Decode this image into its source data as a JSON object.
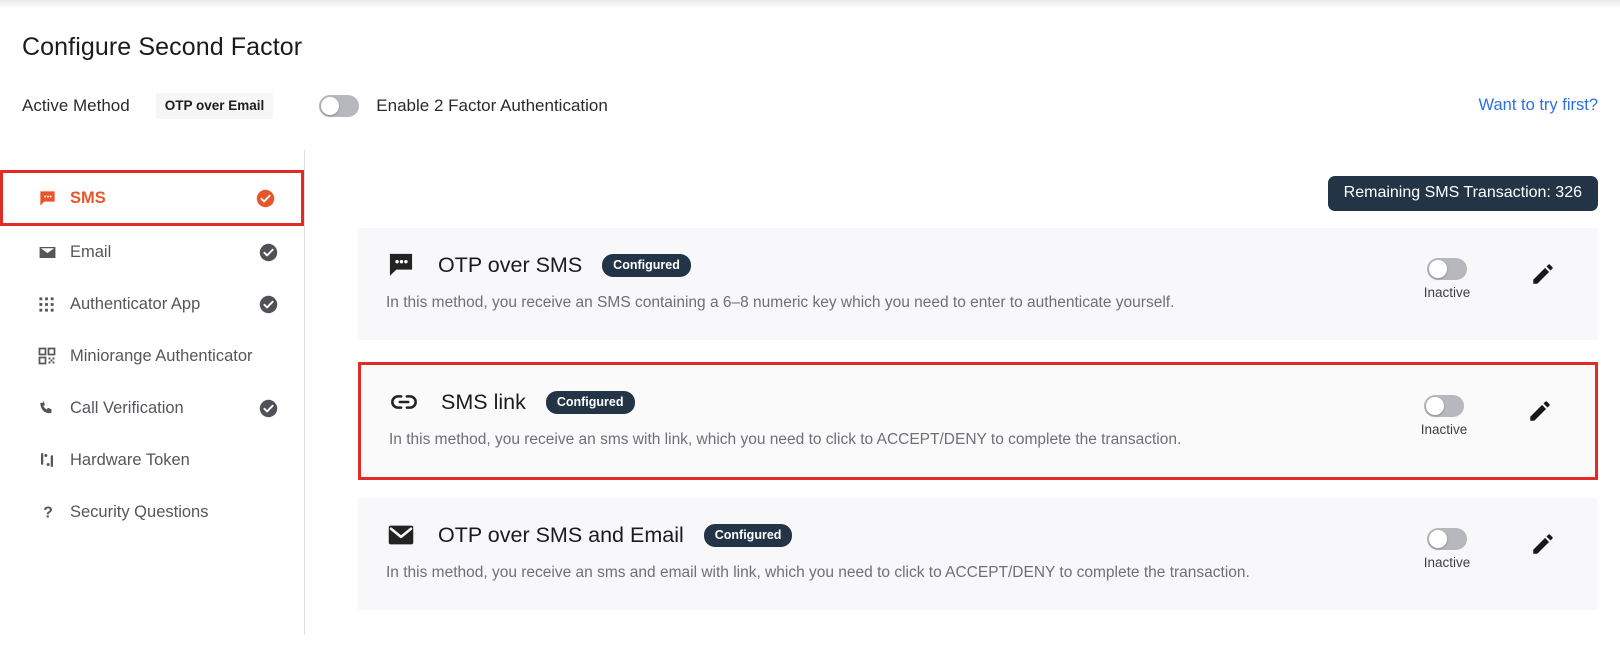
{
  "header": {
    "title": "Configure Second Factor",
    "active_method_label": "Active Method",
    "active_method_value": "OTP over Email",
    "enable_2fa_label": "Enable 2 Factor Authentication",
    "enable_2fa_state": "off",
    "try_first_link": "Want to try first?",
    "link_color": "#2f6fe4"
  },
  "sidebar": {
    "items": [
      {
        "label": "SMS",
        "icon": "sms-chat-icon",
        "configured": true,
        "active": true
      },
      {
        "label": "Email",
        "icon": "envelope-icon",
        "configured": true,
        "active": false
      },
      {
        "label": "Authenticator App",
        "icon": "grid-dots-icon",
        "configured": true,
        "active": false
      },
      {
        "label": "Miniorange Authenticator",
        "icon": "qr-code-icon",
        "configured": false,
        "active": false
      },
      {
        "label": "Call Verification",
        "icon": "phone-icon",
        "configured": true,
        "active": false
      },
      {
        "label": "Hardware Token",
        "icon": "hardware-token-icon",
        "configured": false,
        "active": false
      },
      {
        "label": "Security Questions",
        "icon": "question-mark-icon",
        "configured": false,
        "active": false
      }
    ],
    "active_border_color": "#e22b25",
    "active_text_color": "#e8552b"
  },
  "main": {
    "sms_transaction_badge": "Remaining SMS Transaction: 326",
    "badge_color": "#243447",
    "cards": [
      {
        "icon": "sms-chat-icon",
        "title": "OTP over SMS",
        "status_chip": "Configured",
        "description": "In this method, you receive an SMS containing a 6–8 numeric key which you need to enter to authenticate yourself.",
        "toggle_state": "off",
        "state_label": "Inactive",
        "highlighted": false
      },
      {
        "icon": "link-chain-icon",
        "title": "SMS link",
        "status_chip": "Configured",
        "description": "In this method, you receive an sms with link, which you need to click to ACCEPT/DENY to complete the transaction.",
        "toggle_state": "off",
        "state_label": "Inactive",
        "highlighted": true
      },
      {
        "icon": "envelope-icon",
        "title": "OTP over SMS and Email",
        "status_chip": "Configured",
        "description": "In this method, you receive an sms and email with link, which you need to click to ACCEPT/DENY to complete the transaction.",
        "toggle_state": "off",
        "state_label": "Inactive",
        "highlighted": false
      }
    ],
    "edit_icon": "pencil-edit-icon"
  }
}
